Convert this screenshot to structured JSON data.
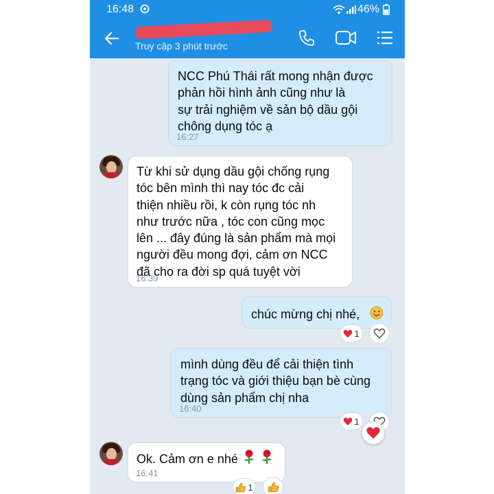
{
  "status_bar": {
    "time": "16:48",
    "battery": "46%"
  },
  "header": {
    "status": "Truy cập 3 phút trước"
  },
  "messages": [
    {
      "dir": "out",
      "text": "NCC Phú Thái rất mong nhận được\nphản hồi hình ảnh cũng như là\nsự trải nghiệm về sản bộ dầu gội\nchông dụng tóc ạ",
      "time": "16:27"
    },
    {
      "dir": "in",
      "text": "Từ khi sử dụng dầu gội chống rụng\ntóc bên mình thì nay tóc đc cải\nthiện nhiều rồi, k còn rụng tóc nh\nnhư trước nữa , tóc con cũng mọc\nlên ... đây đúng là sản phẩm mà mọi\nngười đều mong đợi, cảm ơn NCC\nđã cho ra đời sp quá tuyệt vời",
      "time": "16:39"
    },
    {
      "dir": "out",
      "text": "chúc mừng chị nhé,",
      "time": "",
      "reaction_count": "1"
    },
    {
      "dir": "out",
      "text": "mình dùng đều để cải thiện tình\ntrạng tóc và giới thiệu bạn bè cùng\ndùng sản phẩm chị nha",
      "time": "16:40",
      "reaction_count": "1"
    },
    {
      "dir": "in",
      "text": "Ok. Cảm ơn e nhé",
      "time": "16:41",
      "reaction_count": "1"
    }
  ],
  "icons": {
    "back": "arrow-left-icon",
    "call": "phone-icon",
    "video": "video-call-icon",
    "menu": "list-menu-icon",
    "heart": "heart-icon",
    "like": "thumbs-up-icon",
    "rose": "rose-icon",
    "emoji": "smiling-face-icon"
  },
  "colors": {
    "header": "#1f8fe5",
    "chat_bg": "#e2e9f1",
    "outgoing": "#d4ecfb",
    "incoming": "#ffffff",
    "heart": "#e0283a"
  }
}
